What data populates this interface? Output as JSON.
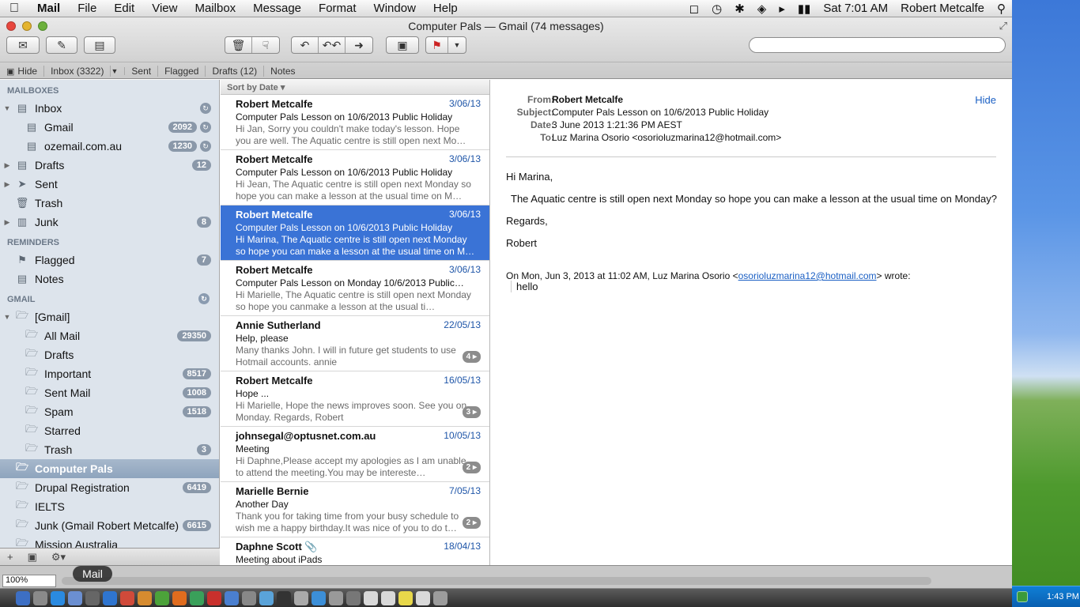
{
  "menubar": {
    "app": "Mail",
    "items": [
      "File",
      "Edit",
      "View",
      "Mailbox",
      "Message",
      "Format",
      "Window",
      "Help"
    ],
    "clock": "Sat 7:01 AM",
    "user": "Robert Metcalfe"
  },
  "window": {
    "title": "Computer Pals — Gmail (74 messages)"
  },
  "favorites": {
    "hide": "Hide",
    "inbox": "Inbox (3322)",
    "sent": "Sent",
    "flagged": "Flagged",
    "drafts": "Drafts (12)",
    "notes": "Notes"
  },
  "sidebar": {
    "mailboxes_header": "MAILBOXES",
    "inbox": "Inbox",
    "gmail": {
      "label": "Gmail",
      "count": "2092"
    },
    "ozemail": {
      "label": "ozemail.com.au",
      "count": "1230"
    },
    "drafts": {
      "label": "Drafts",
      "count": "12"
    },
    "sent": "Sent",
    "trash": "Trash",
    "junk": {
      "label": "Junk",
      "count": "8"
    },
    "reminders_header": "REMINDERS",
    "flagged": {
      "label": "Flagged",
      "count": "7"
    },
    "notes": "Notes",
    "gmail_header": "GMAIL",
    "gmail_root": "[Gmail]",
    "all_mail": {
      "label": "All Mail",
      "count": "29350"
    },
    "g_drafts": "Drafts",
    "important": {
      "label": "Important",
      "count": "8517"
    },
    "sent_mail": {
      "label": "Sent Mail",
      "count": "1008"
    },
    "spam": {
      "label": "Spam",
      "count": "1518"
    },
    "starred": "Starred",
    "g_trash": {
      "label": "Trash",
      "count": "3"
    },
    "computer_pals": "Computer Pals",
    "drupal": {
      "label": "Drupal Registration",
      "count": "6419"
    },
    "ielts": "IELTS",
    "junk_gmail": {
      "label": "Junk (Gmail Robert Metcalfe)",
      "count": "6615"
    },
    "cut_off": "Mission Australia"
  },
  "list": {
    "sort_label": "Sort by Date ▾",
    "messages": [
      {
        "from": "Robert Metcalfe",
        "date": "3/06/13",
        "subject": "Computer Pals Lesson on 10/6/2013 Public Holiday",
        "preview": "Hi Jan,  Sorry you couldn't make today's lesson.  Hope you are well.  The Aquatic centre is still open next Mo…",
        "thread": ""
      },
      {
        "from": "Robert Metcalfe",
        "date": "3/06/13",
        "subject": "Computer Pals Lesson on 10/6/2013 Public Holiday",
        "preview": "Hi Jean,  The Aquatic centre is still open next Monday so hope you can make a lesson at the usual time on M…",
        "thread": ""
      },
      {
        "from": "Robert Metcalfe",
        "date": "3/06/13",
        "subject": "Computer Pals Lesson on 10/6/2013 Public Holiday",
        "preview": "Hi Marina,  The Aquatic centre is still open next Monday so hope you can make a lesson at the usual time on M…",
        "thread": ""
      },
      {
        "from": "Robert Metcalfe",
        "date": "3/06/13",
        "subject": "Computer Pals Lesson on Monday 10/6/2013 Public…",
        "preview": "Hi Marielle,  The Aquatic centre is still open next Monday so hope you canmake a lesson at the usual ti…",
        "thread": ""
      },
      {
        "from": "Annie Sutherland",
        "date": "22/05/13",
        "subject": "Help, please",
        "preview": "Many thanks John. I will in future get students to use Hotmail accounts. annie",
        "thread": "4 ▸"
      },
      {
        "from": "Robert Metcalfe",
        "date": "16/05/13",
        "subject": "Hope ...",
        "preview": "Hi Marielle,  Hope the news improves soon.  See you on Monday. Regards, Robert",
        "thread": "3 ▸"
      },
      {
        "from": "johnsegal@optusnet.com.au",
        "date": "10/05/13",
        "subject": "Meeting",
        "preview": "Hi Daphne,Please accept my apologies as I am unable to attend the meeting.You may be intereste…",
        "thread": "2 ▸"
      },
      {
        "from": "Marielle Bernie",
        "date": "7/05/13",
        "subject": "Another Day",
        "preview": "Thank you for taking time from your busy schedule to wish me a happy birthday.It was nice of you to do t…",
        "thread": "2 ▸"
      },
      {
        "from": "Daphne Scott",
        "date": "18/04/13",
        "subject": "Meeting about iPads",
        "preview": "",
        "thread": ""
      }
    ]
  },
  "reader": {
    "from_label": "From:",
    "subject_label": "Subject:",
    "date_label": "Date:",
    "to_label": "To:",
    "from": "Robert Metcalfe",
    "subject": "Computer Pals Lesson on 10/6/2013 Public Holiday",
    "date": "3 June 2013 1:21:36 PM AEST",
    "to": "Luz Marina Osorio <osorioluzmarina12@hotmail.com>",
    "hide": "Hide",
    "greeting": "Hi Marina,",
    "body": "The Aquatic centre is still open next Monday so hope you can make a lesson at the usual time on Monday?",
    "regards": "Regards,",
    "signature": "Robert",
    "quote_intro": "On Mon, Jun 3, 2013 at 11:02 AM, Luz Marina Osorio <",
    "quote_email": "osorioluzmarina12@hotmail.com",
    "quote_outro": "> wrote:",
    "quote_text": "hello"
  },
  "status": {
    "zoom": "100%",
    "tooltip": "Mail"
  },
  "systray": {
    "clock": "1:43 PM"
  },
  "colors": {
    "selection": "#3a73d6",
    "sidebar_bg": "#dde4ec",
    "link": "#1a5fc4"
  }
}
